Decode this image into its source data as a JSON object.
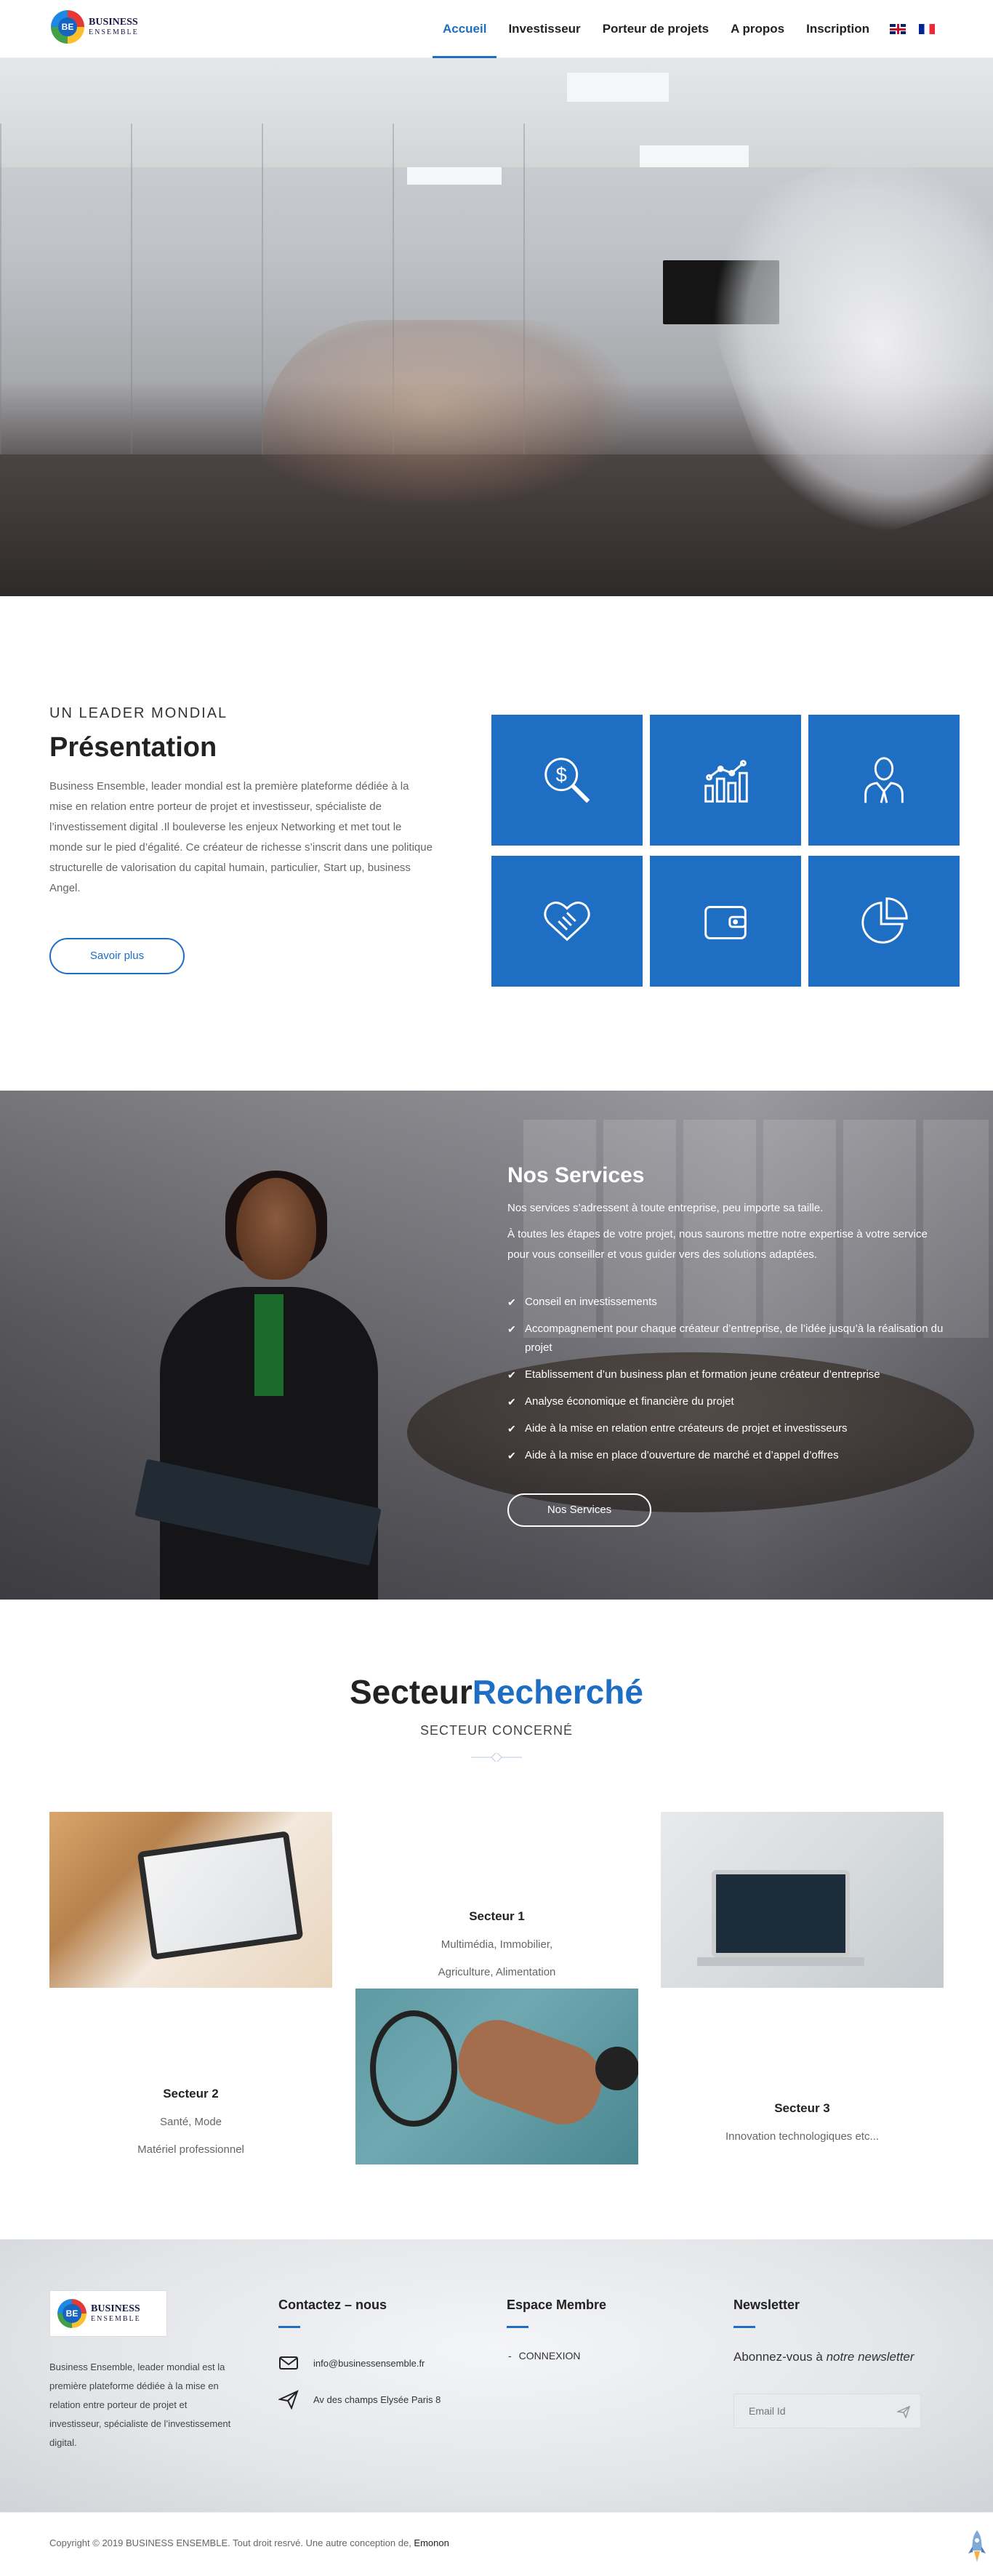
{
  "nav": {
    "items": [
      {
        "label": "Accueil",
        "active": true
      },
      {
        "label": "Investisseur"
      },
      {
        "label": "Porteur de projets"
      },
      {
        "label": "A propos"
      },
      {
        "label": "Inscription"
      }
    ],
    "flags": [
      "uk-flag-icon",
      "fr-flag-icon"
    ]
  },
  "logo": {
    "line1": "BUSINESS",
    "line2": "ENSEMBLE",
    "mark": "BE"
  },
  "presentation": {
    "kicker": "UN LEADER MONDIAL",
    "title": "Présentation",
    "text": "Business Ensemble, leader mondial est la première plateforme dédiée à la mise en relation entre porteur de projet et investisseur, spécialiste de l’investissement digital .Il bouleverse les enjeux Networking et met tout le monde  sur le pied d’égalité. Ce créateur de richesse s’inscrit dans une politique structurelle de valorisation du capital humain, particulier, Start up, business Angel.",
    "button": "Savoir plus",
    "tiles": [
      "dollar-search-icon",
      "bar-chart-icon",
      "businessman-icon",
      "handshake-icon",
      "wallet-icon",
      "pie-chart-icon"
    ]
  },
  "services": {
    "title": "Nos Services",
    "p1": "Nos services s’adressent à toute entreprise, peu importe sa taille.",
    "p2": "À toutes les étapes de votre projet, nous saurons mettre notre expertise à votre service pour vous conseiller et vous guider vers des solutions adaptées.",
    "list": [
      "Conseil en investissements",
      "Accompagnement pour chaque créateur d’entreprise, de l’idée jusqu’à la réalisation du projet",
      "Etablissement d’un business plan et formation jeune créateur d’entreprise",
      "Analyse économique et financière du projet",
      "Aide à la mise en relation entre créateurs de projet et investisseurs",
      "Aide à la mise en place d’ouverture de marché et d’appel d’offres"
    ],
    "button": "Nos Services"
  },
  "secteur": {
    "title_a": "Secteur",
    "title_b": "Recherché",
    "subtitle": "SECTEUR CONCERNÉ",
    "s1": {
      "title": "Secteur 1",
      "l1": "Multimédia, Immobilier,",
      "l2": "Agriculture, Alimentation"
    },
    "s2": {
      "title": "Secteur 2",
      "l1": "Santé, Mode",
      "l2": "Matériel professionnel"
    },
    "s3": {
      "title": "Secteur 3",
      "l1": "Innovation technologiques etc..."
    }
  },
  "footer": {
    "desc": "Business Ensemble, leader mondial est la première plateforme dédiée à la mise en relation entre porteur de projet et investisseur, spécialiste de l’investissement digital.",
    "contact_title": "Contactez – nous",
    "email": "info@businessensemble.fr",
    "address": "Av des champs Elysée Paris 8",
    "member_title": "Espace Membre",
    "member_link": "CONNEXION",
    "news_title": "Newsletter",
    "news_text_a": "Abonnez-vous à ",
    "news_text_b": "notre newsletter",
    "email_placeholder": "Email Id"
  },
  "bottom": {
    "copyright": "Copyright © 2019 BUSINESS ENSEMBLE. Tout droit resrvé. Une autre conception de, ",
    "author": "Emonon"
  },
  "colors": {
    "accent": "#1e6ec4"
  }
}
